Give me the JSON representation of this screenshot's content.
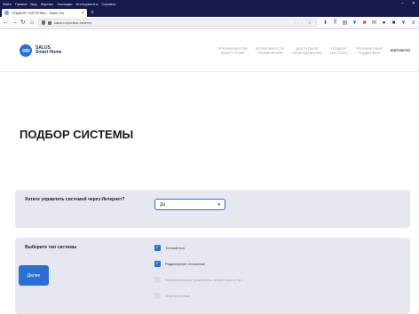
{
  "browser": {
    "menu": [
      "Файл",
      "Правка",
      "Вид",
      "Журнал",
      "Закладки",
      "Инструменты",
      "Справка"
    ],
    "tab_title": "ПОДБОР СИСТЕМЫ - Salus Sm",
    "url": "salus.ru/podbor-sistemy"
  },
  "site": {
    "logo_line1": "SALUS",
    "logo_line2": "Smart Home",
    "nav": [
      {
        "line1": "ПРЕИМУЩЕСТВА",
        "line2": "SMART HOME"
      },
      {
        "line1": "ВОЗМОЖНОСТИ",
        "line2": "ПРИМЕНЕНИЯ"
      },
      {
        "line1": "ДОСТУПНОЕ",
        "line2": "ОБОРУДОВАНИЕ"
      },
      {
        "line1": "ПОДБОР",
        "line2": "СИСТЕМЫ"
      },
      {
        "line1": "ТЕХНИЧЕСКАЯ",
        "line2": "ПОДДЕРЖКА"
      },
      {
        "line1": "КОНТАКТЫ",
        "line2": ""
      }
    ]
  },
  "page": {
    "title": "ПОДБОР СИСТЕМЫ",
    "internet_question": "Хотите управлять системой через Интернет?",
    "internet_value": "Да",
    "system_type_label": "Выберите тип системы",
    "system_types": [
      {
        "label": "Теплый пол",
        "checked": true,
        "enabled": true
      },
      {
        "label": "Радиаторное отопление",
        "checked": true,
        "enabled": true
      },
      {
        "label": "Нагревательные (фанкойлы, конвекторы и пр.)",
        "checked": false,
        "enabled": false
      },
      {
        "label": "Электрический",
        "checked": false,
        "enabled": false
      }
    ],
    "next_button": "Далее"
  },
  "colors": {
    "accent": "#2b6fd6",
    "titlebar": "#16194b",
    "row_bg": "#e5e8ee"
  }
}
